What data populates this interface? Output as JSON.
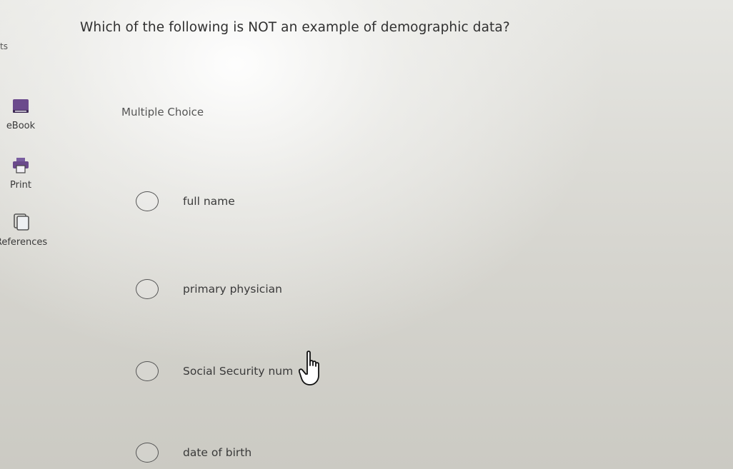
{
  "question": {
    "text": "Which of the following is NOT an example of demographic data?",
    "points_fragment": "ts"
  },
  "sidebar": {
    "items": [
      {
        "label": "eBook",
        "icon": "book-icon"
      },
      {
        "label": "Print",
        "icon": "printer-icon"
      },
      {
        "label": "References",
        "icon": "references-icon"
      }
    ]
  },
  "main": {
    "question_type": "Multiple Choice",
    "options": [
      {
        "label": "full name",
        "selected": false
      },
      {
        "label": "primary physician",
        "selected": false
      },
      {
        "label": "Social Security num",
        "selected": false
      },
      {
        "label": "date of birth",
        "selected": false
      }
    ]
  },
  "colors": {
    "text": "#333333",
    "book_icon": "#6b4a8c",
    "icon_gray": "#555555"
  }
}
